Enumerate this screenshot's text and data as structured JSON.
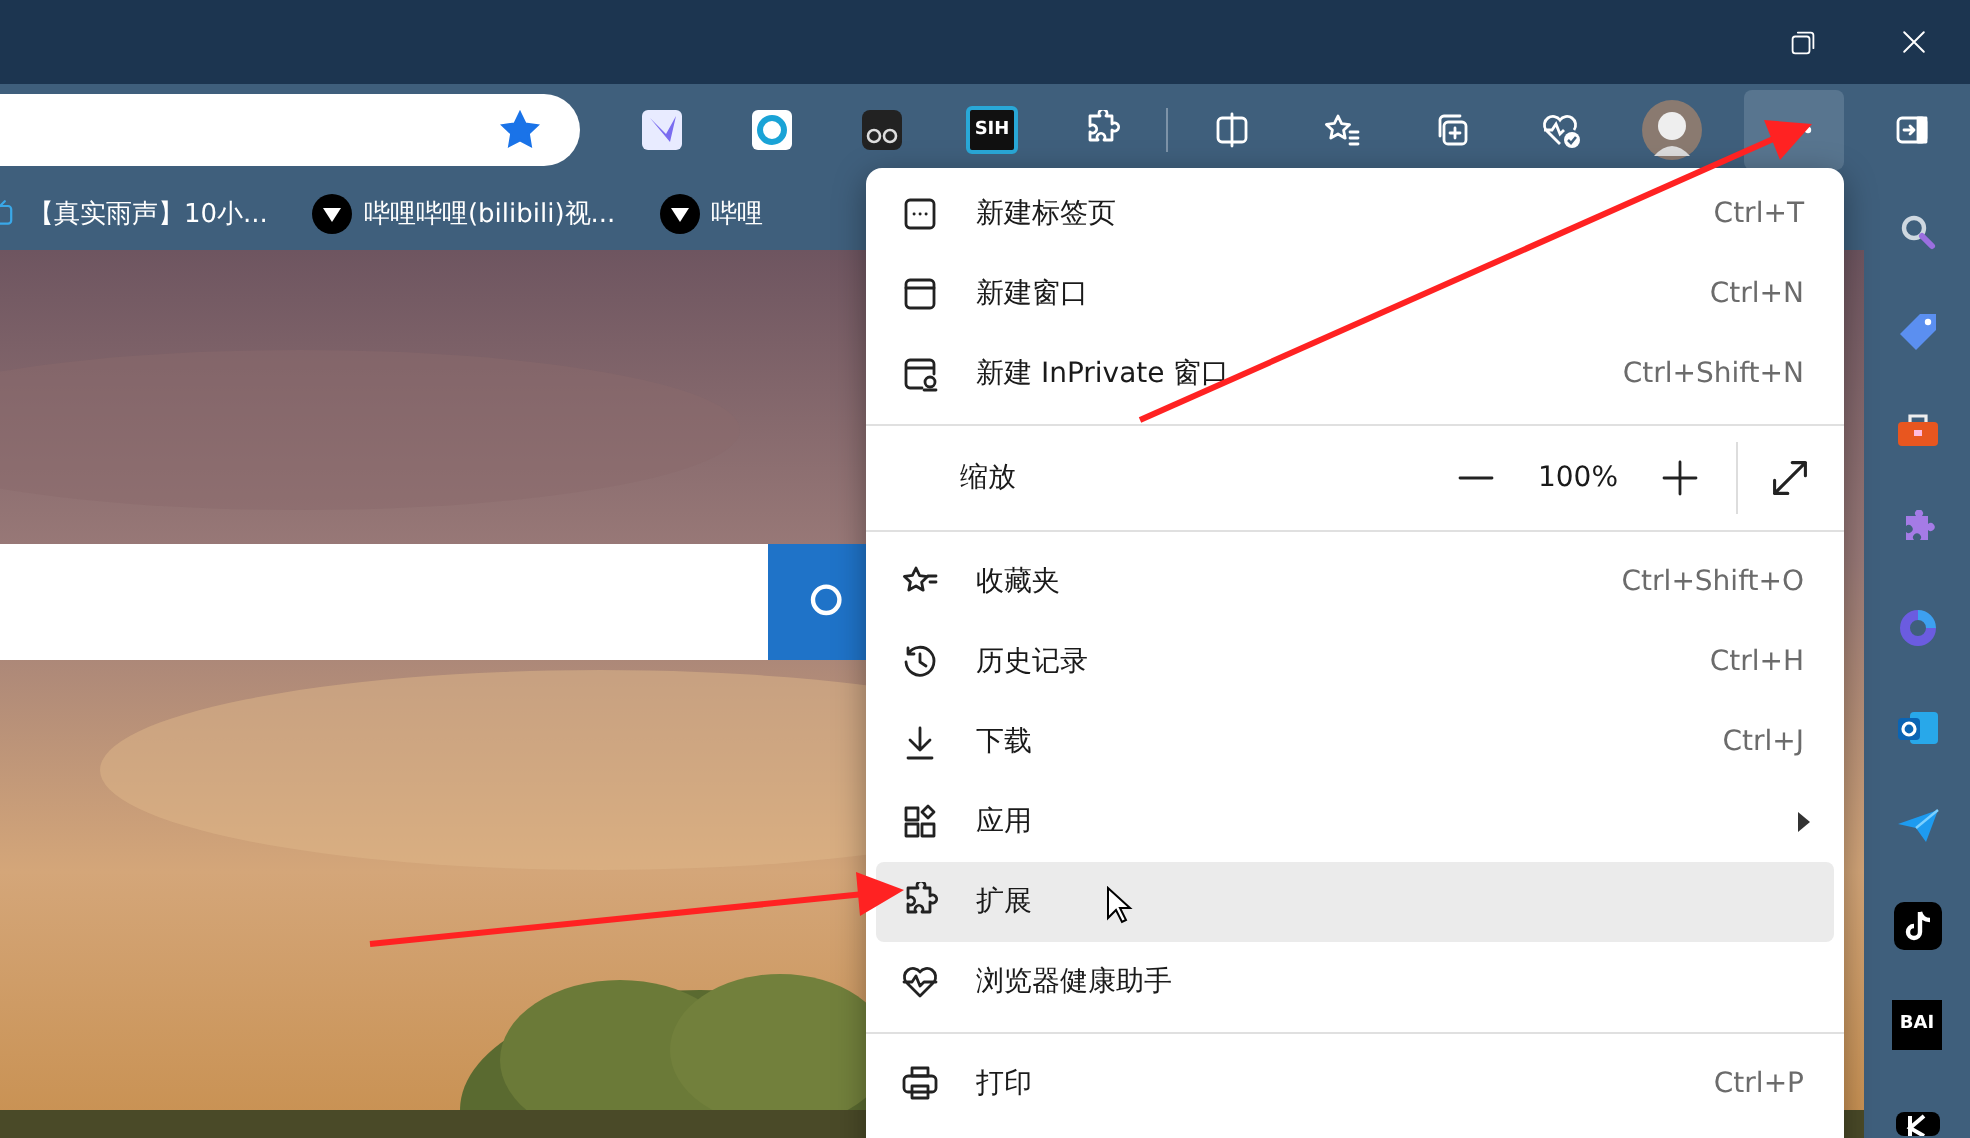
{
  "window_controls": [
    {
      "kind": "restore"
    },
    {
      "kind": "close"
    }
  ],
  "address_bar": {
    "favorited": true
  },
  "toolbar": [
    {
      "kind": "bird"
    },
    {
      "kind": "ring"
    },
    {
      "kind": "glasses"
    },
    {
      "kind": "badge",
      "label": "SIH"
    },
    {
      "kind": "puzzle"
    },
    {
      "kind": "divider"
    },
    {
      "kind": "split"
    },
    {
      "kind": "favorites"
    },
    {
      "kind": "collections"
    },
    {
      "kind": "health"
    },
    {
      "kind": "avatar"
    },
    {
      "kind": "more",
      "selected": true
    },
    {
      "kind": "panel"
    }
  ],
  "bookmarks": [
    {
      "kind": "tv",
      "label": "【真实雨声】10小..."
    },
    {
      "kind": "play",
      "label": "哔哩哔哩(bilibili)视..."
    },
    {
      "kind": "play",
      "label": "哔哩"
    }
  ],
  "menu": [
    {
      "kind": "tab",
      "label": "新建标签页",
      "shortcut": "Ctrl+T",
      "hovered": false
    },
    {
      "kind": "window",
      "label": "新建窗口",
      "shortcut": "Ctrl+N",
      "hovered": false
    },
    {
      "kind": "private",
      "label": "新建 InPrivate 窗口",
      "shortcut": "Ctrl+Shift+N",
      "hovered": false
    },
    {
      "kind": "divider"
    },
    {
      "kind": "zoom",
      "label": "缩放",
      "value": "100%"
    },
    {
      "kind": "divider"
    },
    {
      "kind": "star",
      "label": "收藏夹",
      "shortcut": "Ctrl+Shift+O",
      "hovered": false
    },
    {
      "kind": "history",
      "label": "历史记录",
      "shortcut": "Ctrl+H",
      "hovered": false
    },
    {
      "kind": "download",
      "label": "下载",
      "shortcut": "Ctrl+J",
      "hovered": false
    },
    {
      "kind": "apps",
      "label": "应用",
      "submenu": true,
      "hovered": false
    },
    {
      "kind": "puzzle",
      "label": "扩展",
      "hovered": true
    },
    {
      "kind": "health",
      "label": "浏览器健康助手",
      "hovered": false
    },
    {
      "kind": "divider"
    },
    {
      "kind": "print",
      "label": "打印",
      "shortcut": "Ctrl+P",
      "hovered": false
    }
  ],
  "sidebar": [
    {
      "kind": "search"
    },
    {
      "kind": "tag"
    },
    {
      "kind": "toolbox"
    },
    {
      "kind": "puzzle"
    },
    {
      "kind": "office"
    },
    {
      "kind": "outlook"
    },
    {
      "kind": "send"
    },
    {
      "kind": "tiktok"
    },
    {
      "kind": "badge",
      "label": "BAI"
    },
    {
      "kind": "k"
    }
  ]
}
